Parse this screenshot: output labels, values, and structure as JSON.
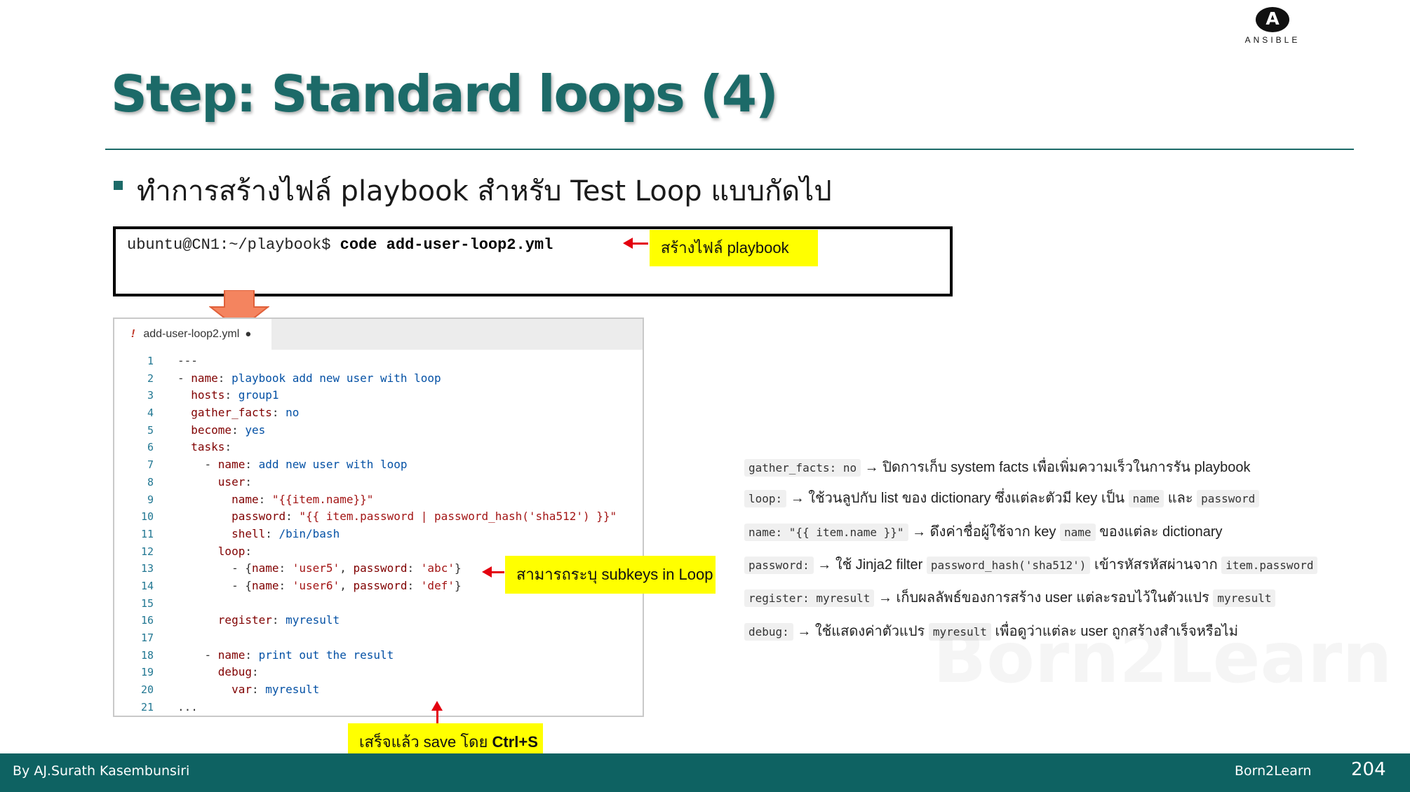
{
  "logo": {
    "mark": "A",
    "text": "ANSIBLE"
  },
  "slide": {
    "title": "Step: Standard loops (4)",
    "bullet": "ทำการสร้างไฟล์ playbook สำหรับ Test Loop แบบกัดไป"
  },
  "terminal": {
    "prompt": "ubuntu@CN1:~/playbook$ ",
    "command": "code add-user-loop2.yml"
  },
  "callouts": {
    "create_file": "สร้างไฟล์ playbook",
    "subkeys": "สามารถระบุ subkeys in Loop",
    "save_prefix": "เสร็จแล้ว  save โดย ",
    "save_keys": "Ctrl+S"
  },
  "editor": {
    "tab_warning": "!",
    "tab_name": "add-user-loop2.yml",
    "tab_dirty": "●",
    "lines": [
      {
        "n": "1",
        "s": [
          {
            "t": "---",
            "c": "o"
          }
        ]
      },
      {
        "n": "2",
        "s": [
          {
            "t": "- ",
            "c": "o"
          },
          {
            "t": "name",
            "c": "k"
          },
          {
            "t": ": ",
            "c": "o"
          },
          {
            "t": "playbook add new user with loop",
            "c": "v"
          }
        ]
      },
      {
        "n": "3",
        "s": [
          {
            "t": "  ",
            "c": "o"
          },
          {
            "t": "hosts",
            "c": "k"
          },
          {
            "t": ": ",
            "c": "o"
          },
          {
            "t": "group1",
            "c": "v"
          }
        ]
      },
      {
        "n": "4",
        "s": [
          {
            "t": "  ",
            "c": "o"
          },
          {
            "t": "gather_facts",
            "c": "k"
          },
          {
            "t": ": ",
            "c": "o"
          },
          {
            "t": "no",
            "c": "v"
          }
        ]
      },
      {
        "n": "5",
        "s": [
          {
            "t": "  ",
            "c": "o"
          },
          {
            "t": "become",
            "c": "k"
          },
          {
            "t": ": ",
            "c": "o"
          },
          {
            "t": "yes",
            "c": "v"
          }
        ]
      },
      {
        "n": "6",
        "s": [
          {
            "t": "  ",
            "c": "o"
          },
          {
            "t": "tasks",
            "c": "k"
          },
          {
            "t": ":",
            "c": "o"
          }
        ]
      },
      {
        "n": "7",
        "s": [
          {
            "t": "    - ",
            "c": "o"
          },
          {
            "t": "name",
            "c": "k"
          },
          {
            "t": ": ",
            "c": "o"
          },
          {
            "t": "add new user with loop",
            "c": "v"
          }
        ]
      },
      {
        "n": "8",
        "s": [
          {
            "t": "      ",
            "c": "o"
          },
          {
            "t": "user",
            "c": "k"
          },
          {
            "t": ":",
            "c": "o"
          }
        ]
      },
      {
        "n": "9",
        "s": [
          {
            "t": "        ",
            "c": "o"
          },
          {
            "t": "name",
            "c": "k"
          },
          {
            "t": ": ",
            "c": "o"
          },
          {
            "t": "\"{{item.name}}\"",
            "c": "s"
          }
        ]
      },
      {
        "n": "10",
        "s": [
          {
            "t": "        ",
            "c": "o"
          },
          {
            "t": "password",
            "c": "k"
          },
          {
            "t": ": ",
            "c": "o"
          },
          {
            "t": "\"{{ item.password | password_hash('sha512') }}\"",
            "c": "s"
          }
        ]
      },
      {
        "n": "11",
        "s": [
          {
            "t": "        ",
            "c": "o"
          },
          {
            "t": "shell",
            "c": "k"
          },
          {
            "t": ": ",
            "c": "o"
          },
          {
            "t": "/bin/bash",
            "c": "v"
          }
        ]
      },
      {
        "n": "12",
        "s": [
          {
            "t": "      ",
            "c": "o"
          },
          {
            "t": "loop",
            "c": "k"
          },
          {
            "t": ":",
            "c": "o"
          }
        ]
      },
      {
        "n": "13",
        "s": [
          {
            "t": "        - {",
            "c": "o"
          },
          {
            "t": "name",
            "c": "k"
          },
          {
            "t": ": ",
            "c": "o"
          },
          {
            "t": "'user5'",
            "c": "s"
          },
          {
            "t": ", ",
            "c": "o"
          },
          {
            "t": "password",
            "c": "k"
          },
          {
            "t": ": ",
            "c": "o"
          },
          {
            "t": "'abc'",
            "c": "s"
          },
          {
            "t": "}",
            "c": "o"
          }
        ]
      },
      {
        "n": "14",
        "s": [
          {
            "t": "        - {",
            "c": "o"
          },
          {
            "t": "name",
            "c": "k"
          },
          {
            "t": ": ",
            "c": "o"
          },
          {
            "t": "'user6'",
            "c": "s"
          },
          {
            "t": ", ",
            "c": "o"
          },
          {
            "t": "password",
            "c": "k"
          },
          {
            "t": ": ",
            "c": "o"
          },
          {
            "t": "'def'",
            "c": "s"
          },
          {
            "t": "}",
            "c": "o"
          }
        ]
      },
      {
        "n": "15",
        "s": []
      },
      {
        "n": "16",
        "s": [
          {
            "t": "      ",
            "c": "o"
          },
          {
            "t": "register",
            "c": "k"
          },
          {
            "t": ": ",
            "c": "o"
          },
          {
            "t": "myresult",
            "c": "v"
          }
        ]
      },
      {
        "n": "17",
        "s": []
      },
      {
        "n": "18",
        "s": [
          {
            "t": "    - ",
            "c": "o"
          },
          {
            "t": "name",
            "c": "k"
          },
          {
            "t": ": ",
            "c": "o"
          },
          {
            "t": "print out the result",
            "c": "v"
          }
        ]
      },
      {
        "n": "19",
        "s": [
          {
            "t": "      ",
            "c": "o"
          },
          {
            "t": "debug",
            "c": "k"
          },
          {
            "t": ":",
            "c": "o"
          }
        ]
      },
      {
        "n": "20",
        "s": [
          {
            "t": "        ",
            "c": "o"
          },
          {
            "t": "var",
            "c": "k"
          },
          {
            "t": ": ",
            "c": "o"
          },
          {
            "t": "myresult",
            "c": "v"
          }
        ]
      },
      {
        "n": "21",
        "s": [
          {
            "t": "...",
            "c": "o"
          }
        ]
      }
    ]
  },
  "annotations": [
    [
      {
        "code": "gather_facts: no"
      },
      {
        "text": " → ปิดการเก็บ system facts เพื่อเพิ่มความเร็วในการรัน playbook"
      }
    ],
    [
      {
        "code": "loop:"
      },
      {
        "text": " → ใช้วนลูปกับ list ของ dictionary ซึ่งแต่ละตัวมี key เป็น "
      },
      {
        "code": "name"
      },
      {
        "text": " และ "
      },
      {
        "code": "password"
      }
    ],
    [
      {
        "code": "name: \"{{ item.name }}\""
      },
      {
        "text": " → ดึงค่าชื่อผู้ใช้จาก key "
      },
      {
        "code": "name"
      },
      {
        "text": " ของแต่ละ dictionary"
      }
    ],
    [
      {
        "code": "password:"
      },
      {
        "text": " → ใช้ Jinja2 filter "
      },
      {
        "code": "password_hash('sha512')"
      },
      {
        "text": " เข้ารหัสรหัสผ่านจาก "
      },
      {
        "code": "item.password"
      }
    ],
    [
      {
        "code": "register: myresult"
      },
      {
        "text": " → เก็บผลลัพธ์ของการสร้าง user แต่ละรอบไว้ในตัวแปร "
      },
      {
        "code": "myresult"
      }
    ],
    [
      {
        "code": "debug:"
      },
      {
        "text": " → ใช้แสดงค่าตัวแปร "
      },
      {
        "code": "myresult"
      },
      {
        "text": " เพื่อดูว่าแต่ละ user ถูกสร้างสำเร็จหรือไม่"
      }
    ]
  ],
  "watermark": "Born2Learn",
  "footer": {
    "author": "By AJ.Surath Kasembunsiri",
    "brand": "Born2Learn",
    "page": "204"
  },
  "colors": {
    "accent": "#1c6a68",
    "footer": "#0e6262",
    "callout": "#ffff00",
    "arrow": "#e3000f",
    "pointer": "#f4845f"
  }
}
